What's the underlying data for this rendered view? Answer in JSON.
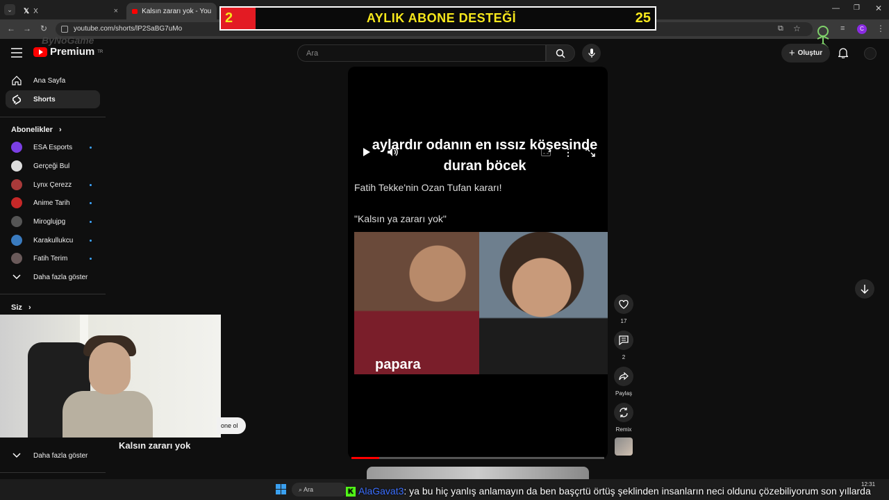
{
  "browser": {
    "tabs": [
      {
        "label": "X",
        "close": "×"
      },
      {
        "label": "Kalsın zararı yok - YouTube",
        "close": "×"
      }
    ],
    "url": "youtube.com/shorts/lP2SaBG7uMo",
    "profile_initial": "C"
  },
  "banner": {
    "left_number": "2",
    "title": "AYLIK ABONE DESTEĞİ",
    "right_number": "25"
  },
  "header": {
    "logo_text": "Premium",
    "logo_region": "TR",
    "watermark": "ByNoGame",
    "search_placeholder": "Ara",
    "create_label": "Oluştur"
  },
  "sidebar": {
    "main": [
      {
        "label": "Ana Sayfa"
      },
      {
        "label": "Shorts"
      }
    ],
    "subscriptions_title": "Abonelikler",
    "subscriptions": [
      {
        "label": "ESA Esports",
        "color": "#7b3fe4",
        "new": true
      },
      {
        "label": "Gerçeği Bul",
        "color": "#dddddd",
        "new": false
      },
      {
        "label": "Lynx Çerezz",
        "color": "#a83a3a",
        "new": true
      },
      {
        "label": "Anime Tarih",
        "color": "#c62828",
        "new": true
      },
      {
        "label": "Miroglujpg",
        "color": "#555555",
        "new": true
      },
      {
        "label": "Karakullukcu",
        "color": "#3a7bbf",
        "new": true
      },
      {
        "label": "Fatih Terim",
        "color": "#6a5a5a",
        "new": true
      }
    ],
    "show_more": "Daha fazla göster",
    "you_title": "Siz",
    "show_more_2": "Daha fazla göster"
  },
  "video": {
    "headline": "aylardır odanın en ıssız köşesinde duran böcek",
    "caption1": "Fatih Tekke'nin Ozan Tufan kararı!",
    "caption2": "\"Kalsın ya zararı yok\"",
    "jersey_text": "papara",
    "title": "Kalsın zararı yok",
    "progress": 0.11
  },
  "actions": {
    "likes": "17",
    "comments": "2",
    "share": "Paylaş",
    "remix": "Remix"
  },
  "subscribe_partial": "one ol",
  "taskbar": {
    "search": "Ara",
    "time": "12:31"
  },
  "ticker": {
    "user": "AlaGavat3",
    "message": ": ya bu hiç yanlış anlamayın da ben başçrtü örtüş şeklinden insanların neci oldunu çözebiliyorum son yıllarda"
  }
}
